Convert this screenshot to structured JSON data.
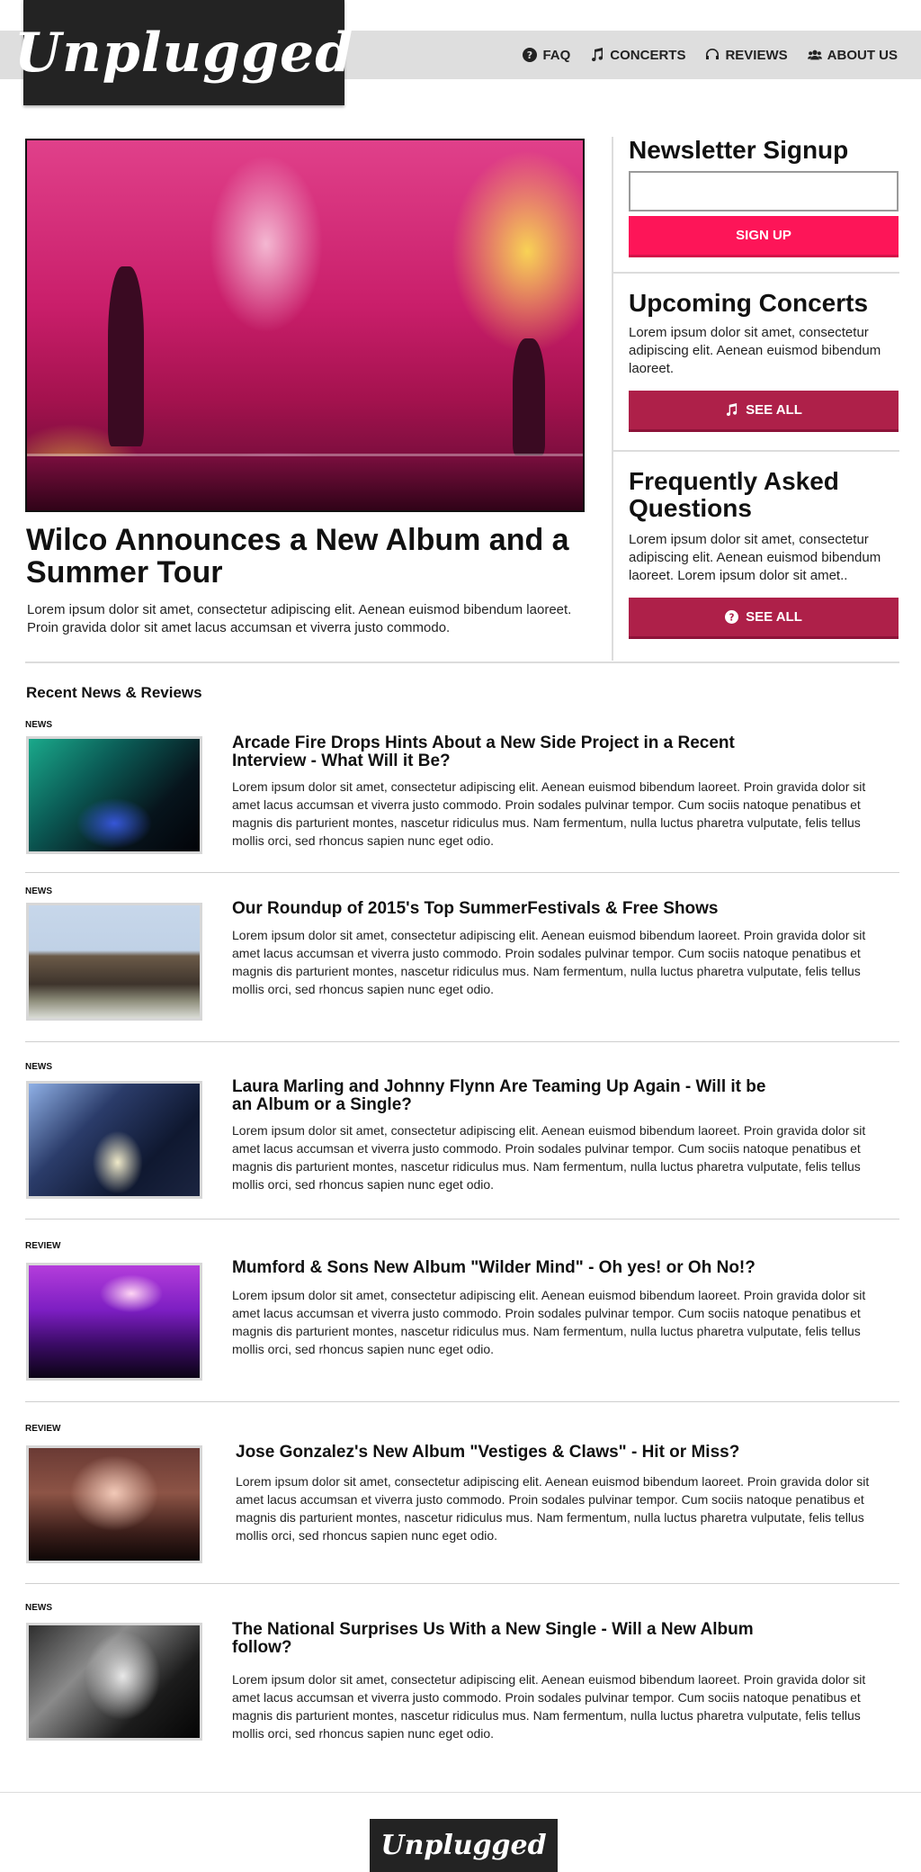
{
  "brand": {
    "logo": "Unplugged"
  },
  "nav": [
    {
      "label": "FAQ",
      "icon": "question-circle-icon"
    },
    {
      "label": "CONCERTS",
      "icon": "music-note-icon"
    },
    {
      "label": "REVIEWS",
      "icon": "headphones-icon"
    },
    {
      "label": "ABOUT US",
      "icon": "users-icon"
    }
  ],
  "hero": {
    "title": "Wilco Announces a New Album and a Summer Tour",
    "text": "Lorem ipsum dolor sit amet, consectetur adipiscing elit. Aenean euismod bibendum laoreet. Proin gravida dolor sit amet lacus accumsan et viverra justo commodo."
  },
  "sidebar": {
    "newsletter": {
      "title": "Newsletter Signup",
      "input_value": "",
      "button": "SIGN UP"
    },
    "concerts": {
      "title": "Upcoming Concerts",
      "text": "Lorem ipsum dolor sit amet, consectetur adipiscing elit. Aenean euismod bibendum laoreet.",
      "button": "SEE ALL"
    },
    "faq": {
      "title": "Frequently Asked Questions",
      "text": "Lorem ipsum dolor sit amet, consectetur adipiscing elit. Aenean euismod bibendum laoreet. Lorem ipsum dolor sit amet..",
      "button": "SEE ALL"
    }
  },
  "recent": {
    "title": "Recent News & Reviews",
    "items": [
      {
        "tag": "NEWS",
        "title": "Arcade Fire Drops Hints About a New Side Project in a Recent Interview - What Will it Be?",
        "body": "Lorem ipsum dolor sit amet, consectetur adipiscing elit. Aenean euismod bibendum laoreet. Proin gravida dolor sit amet lacus accumsan et viverra justo commodo. Proin sodales pulvinar tempor. Cum sociis natoque penatibus et magnis dis parturient montes, nascetur ridiculus mus. Nam fermentum, nulla luctus pharetra vulputate, felis tellus mollis orci, sed rhoncus sapien nunc eget odio."
      },
      {
        "tag": "NEWS",
        "title": "Our Roundup of 2015's Top SummerFestivals & Free Shows",
        "body": "Lorem ipsum dolor sit amet, consectetur adipiscing elit. Aenean euismod bibendum laoreet. Proin gravida dolor sit amet lacus accumsan et viverra justo commodo. Proin sodales pulvinar tempor. Cum sociis natoque penatibus et magnis dis parturient montes, nascetur ridiculus mus. Nam fermentum, nulla luctus pharetra vulputate, felis tellus mollis orci, sed rhoncus sapien nunc eget odio."
      },
      {
        "tag": "NEWS",
        "title": "Laura Marling and Johnny Flynn Are Teaming Up Again - Will it be an Album or a Single?",
        "body": "Lorem ipsum dolor sit amet, consectetur adipiscing elit. Aenean euismod bibendum laoreet. Proin gravida dolor sit amet lacus accumsan et viverra justo commodo. Proin sodales pulvinar tempor. Cum sociis natoque penatibus et magnis dis parturient montes, nascetur ridiculus mus. Nam fermentum, nulla luctus pharetra vulputate, felis tellus mollis orci, sed rhoncus sapien nunc eget odio."
      },
      {
        "tag": "REVIEW",
        "title": "Mumford & Sons New Album \"Wilder Mind\" - Oh yes! or Oh No!?",
        "body": "Lorem ipsum dolor sit amet, consectetur adipiscing elit. Aenean euismod bibendum laoreet. Proin gravida dolor sit amet lacus accumsan et viverra justo commodo. Proin sodales pulvinar tempor. Cum sociis natoque penatibus et magnis dis parturient montes, nascetur ridiculus mus. Nam fermentum, nulla luctus pharetra vulputate, felis tellus mollis orci, sed rhoncus sapien nunc eget odio."
      },
      {
        "tag": "REVIEW",
        "title": "Jose Gonzalez's New Album  \"Vestiges & Claws\" - Hit or Miss?",
        "body": "Lorem ipsum dolor sit amet, consectetur adipiscing elit. Aenean euismod bibendum laoreet. Proin gravida dolor sit amet lacus accumsan et viverra justo commodo. Proin sodales pulvinar tempor. Cum sociis natoque penatibus et magnis dis parturient montes, nascetur ridiculus mus. Nam fermentum, nulla luctus pharetra vulputate, felis tellus mollis orci, sed rhoncus sapien nunc eget odio."
      },
      {
        "tag": "NEWS",
        "title": "The National Surprises Us With a New Single - Will a New Album follow?",
        "body": "Lorem ipsum dolor sit amet, consectetur adipiscing elit. Aenean euismod bibendum laoreet. Proin gravida dolor sit amet lacus accumsan et viverra justo commodo. Proin sodales pulvinar tempor. Cum sociis natoque penatibus et magnis dis parturient montes, nascetur ridiculus mus. Nam fermentum, nulla luctus pharetra vulputate, felis tellus mollis orci, sed rhoncus sapien nunc eget odio."
      }
    ]
  },
  "footer": {
    "logo": "Unplugged"
  },
  "colors": {
    "pink_button": "#fd1558",
    "wine_button": "#ae2049",
    "logo_bg": "#232323",
    "nav_bg": "#dedede"
  }
}
